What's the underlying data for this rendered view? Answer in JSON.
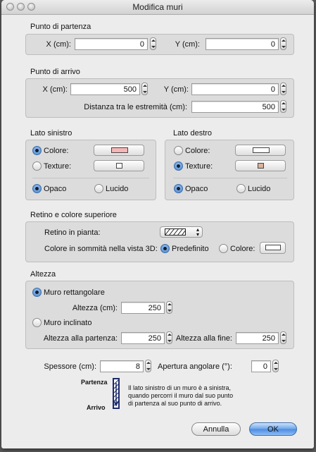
{
  "window": {
    "title": "Modifica muri"
  },
  "start_point": {
    "title": "Punto di partenza",
    "x_label": "X (cm):",
    "x_value": "0",
    "y_label": "Y (cm):",
    "y_value": "0"
  },
  "end_point": {
    "title": "Punto di arrivo",
    "x_label": "X (cm):",
    "x_value": "500",
    "y_label": "Y (cm):",
    "y_value": "0",
    "distance_label": "Distanza tra le estremità (cm):",
    "distance_value": "500"
  },
  "left_side": {
    "title": "Lato sinistro",
    "color_label": "Colore:",
    "texture_label": "Texture:",
    "matt_label": "Opaco",
    "shiny_label": "Lucido",
    "color_swatch": "#f4b6b6",
    "texture_swatch": "#ffffff",
    "selected": "color",
    "finish": "matt"
  },
  "right_side": {
    "title": "Lato destro",
    "color_label": "Colore:",
    "texture_label": "Texture:",
    "matt_label": "Opaco",
    "shiny_label": "Lucido",
    "color_swatch": "#ffffff",
    "texture_swatch": "#d9b29b",
    "selected": "texture",
    "finish": "matt"
  },
  "pattern": {
    "title": "Retino e colore superiore",
    "plan_label": "Retino in pianta:",
    "top_color_label": "Colore in sommità nella vista 3D:",
    "default_label": "Predefinito",
    "color_label": "Colore:",
    "top_swatch": "#ffffff",
    "selected": "default"
  },
  "height": {
    "title": "Altezza",
    "rect_label": "Muro rettangolare",
    "height_label": "Altezza (cm):",
    "height_value": "250",
    "sloping_label": "Muro inclinato",
    "start_label": "Altezza alla partenza:",
    "start_value": "250",
    "end_label": "Altezza alla fine:",
    "end_value": "250",
    "selected": "rectangular"
  },
  "thickness": {
    "label": "Spessore (cm):",
    "value": "8"
  },
  "arc": {
    "label": "Apertura angolare (°):",
    "value": "0"
  },
  "legend": {
    "start": "Partenza",
    "end": "Arrivo",
    "lines": [
      "Il lato sinistro di un muro è a sinistra,",
      "quando percorri il muro dal suo punto",
      "di partenza al suo punto di arrivo."
    ]
  },
  "buttons": {
    "cancel": "Annulla",
    "ok": "OK"
  }
}
